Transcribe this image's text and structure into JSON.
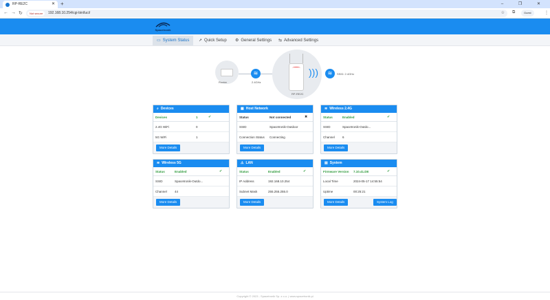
{
  "browser": {
    "tab_title": "RP-RE2C",
    "security_chip": "Not secure",
    "url": "192.168.10.254/cgi-bin/luci/",
    "guest_label": "Guest",
    "new_tab": "+",
    "window_controls": "– ❐ ✕"
  },
  "brand": {
    "logo_text": "Spacetronik"
  },
  "nav": {
    "items": [
      {
        "label": "System Status",
        "icon": "monitor-icon"
      },
      {
        "label": "Quick Setup",
        "icon": "rocket-icon"
      },
      {
        "label": "General Settings",
        "icon": "gear-icon"
      },
      {
        "label": "Advanced Settings",
        "icon": "sliders-icon"
      }
    ]
  },
  "diagram": {
    "router_label": "Router",
    "band_left": "2.4GHz",
    "device_label": "RP-RE2C",
    "right_label": "SSID: 2.4GHz"
  },
  "cards": {
    "devices": {
      "title": "Devices",
      "rows": [
        {
          "k": "Devices",
          "v": "1",
          "c": "✔"
        },
        {
          "k": "2.4G WiFi",
          "v": "0"
        },
        {
          "k": "5G WiFi",
          "v": "1"
        }
      ],
      "button": "More Details"
    },
    "host": {
      "title": "Host Network",
      "rows": [
        {
          "k": "Status",
          "v": "Not connected",
          "c": "✖"
        },
        {
          "k": "SSID",
          "v": "Spacetronik-Outdoor"
        },
        {
          "k": "Connection Status",
          "v": "Connecting"
        }
      ],
      "button": "More Details"
    },
    "w24": {
      "title": "Wireless 2.4G",
      "rows": [
        {
          "k": "Status",
          "v": "Enabled",
          "c": "✔"
        },
        {
          "k": "SSID",
          "v": "Spacetronik-Outdo..."
        },
        {
          "k": "Channel",
          "v": "6"
        }
      ],
      "button": "More Details"
    },
    "w5": {
      "title": "Wireless 5G",
      "rows": [
        {
          "k": "Status",
          "v": "Enabled",
          "c": "✔"
        },
        {
          "k": "SSID",
          "v": "Spacetronik-Outdo..."
        },
        {
          "k": "Channel",
          "v": "44"
        }
      ],
      "button": "More Details"
    },
    "lan": {
      "title": "LAN",
      "rows": [
        {
          "k": "Status",
          "v": "Enabled",
          "c": "✔"
        },
        {
          "k": "IP Address",
          "v": "192.168.10.254"
        },
        {
          "k": "Subnet Mask",
          "v": "255.255.255.0"
        }
      ],
      "button": "More Details"
    },
    "system": {
      "title": "System",
      "rows": [
        {
          "k": "Firmware Version",
          "v": "7.10.41.DE",
          "c": "✔"
        },
        {
          "k": "Local Time",
          "v": "2024-05-17 14:55:54"
        },
        {
          "k": "Uptime",
          "v": "00:25:21"
        }
      ],
      "button": "More Details",
      "button2": "System Log"
    }
  },
  "footer": "Copyright © 2023 - Spacetronik Sp. z o.o.   |   www.spacetronik.pl"
}
